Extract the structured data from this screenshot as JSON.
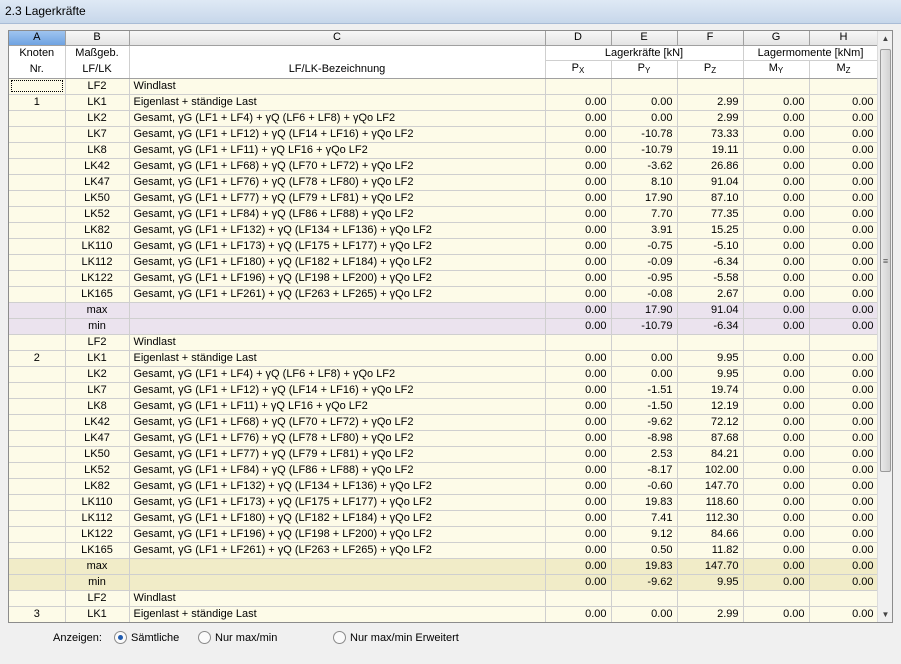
{
  "window": {
    "title": "2.3 Lagerkräfte"
  },
  "columns": {
    "letters": [
      "A",
      "B",
      "C",
      "D",
      "E",
      "F",
      "G",
      "H"
    ],
    "knoten": "Knoten",
    "nr": "Nr.",
    "massgeb": "Maßgeb.",
    "lflk": "LF/LK",
    "bezeichnung": "LF/LK-Bezeichnung",
    "lagerkraefte": "Lagerkräfte [kN]",
    "lagermomente": "Lagermomente [kNm]",
    "px": "P",
    "px_sub": "X",
    "py": "P",
    "py_sub": "Y",
    "pz": "P",
    "pz_sub": "Z",
    "my": "M",
    "my_sub": "Y",
    "mz": "M",
    "mz_sub": "Z"
  },
  "rows": [
    {
      "type": "row",
      "knot": "",
      "lk": "LF2",
      "desc": "Windlast",
      "px": "",
      "py": "",
      "pz": "",
      "my": "",
      "mz": ""
    },
    {
      "type": "row",
      "knot": "1",
      "lk": "LK1",
      "desc": "Eigenlast + ständige Last",
      "px": "0.00",
      "py": "0.00",
      "pz": "2.99",
      "my": "0.00",
      "mz": "0.00"
    },
    {
      "type": "row",
      "knot": "",
      "lk": "LK2",
      "desc": "Gesamt, γG (LF1 + LF4) + γQ (LF6 + LF8) + γQo LF2",
      "px": "0.00",
      "py": "0.00",
      "pz": "2.99",
      "my": "0.00",
      "mz": "0.00"
    },
    {
      "type": "row",
      "knot": "",
      "lk": "LK7",
      "desc": "Gesamt, γG (LF1 + LF12) + γQ (LF14 + LF16) + γQo LF2",
      "px": "0.00",
      "py": "-10.78",
      "pz": "73.33",
      "my": "0.00",
      "mz": "0.00"
    },
    {
      "type": "row",
      "knot": "",
      "lk": "LK8",
      "desc": "Gesamt, γG (LF1 + LF11) + γQ LF16 + γQo LF2",
      "px": "0.00",
      "py": "-10.79",
      "pz": "19.11",
      "my": "0.00",
      "mz": "0.00"
    },
    {
      "type": "row",
      "knot": "",
      "lk": "LK42",
      "desc": "Gesamt, γG (LF1 + LF68) + γQ (LF70 + LF72) + γQo LF2",
      "px": "0.00",
      "py": "-3.62",
      "pz": "26.86",
      "my": "0.00",
      "mz": "0.00"
    },
    {
      "type": "row",
      "knot": "",
      "lk": "LK47",
      "desc": "Gesamt, γG (LF1 + LF76) + γQ (LF78 + LF80) + γQo LF2",
      "px": "0.00",
      "py": "8.10",
      "pz": "91.04",
      "my": "0.00",
      "mz": "0.00"
    },
    {
      "type": "row",
      "knot": "",
      "lk": "LK50",
      "desc": "Gesamt, γG (LF1 + LF77) + γQ (LF79 + LF81) + γQo LF2",
      "px": "0.00",
      "py": "17.90",
      "pz": "87.10",
      "my": "0.00",
      "mz": "0.00"
    },
    {
      "type": "row",
      "knot": "",
      "lk": "LK52",
      "desc": "Gesamt, γG (LF1 + LF84) + γQ (LF86 + LF88) + γQo LF2",
      "px": "0.00",
      "py": "7.70",
      "pz": "77.35",
      "my": "0.00",
      "mz": "0.00"
    },
    {
      "type": "row",
      "knot": "",
      "lk": "LK82",
      "desc": "Gesamt, γG (LF1 + LF132) + γQ (LF134 + LF136) + γQo LF2",
      "px": "0.00",
      "py": "3.91",
      "pz": "15.25",
      "my": "0.00",
      "mz": "0.00"
    },
    {
      "type": "row",
      "knot": "",
      "lk": "LK110",
      "desc": "Gesamt, γG (LF1 + LF173) + γQ (LF175 + LF177) + γQo LF2",
      "px": "0.00",
      "py": "-0.75",
      "pz": "-5.10",
      "my": "0.00",
      "mz": "0.00"
    },
    {
      "type": "row",
      "knot": "",
      "lk": "LK112",
      "desc": "Gesamt, γG (LF1 + LF180) + γQ (LF182 + LF184) + γQo LF2",
      "px": "0.00",
      "py": "-0.09",
      "pz": "-6.34",
      "my": "0.00",
      "mz": "0.00"
    },
    {
      "type": "row",
      "knot": "",
      "lk": "LK122",
      "desc": "Gesamt, γG (LF1 + LF196) + γQ (LF198 + LF200) + γQo LF2",
      "px": "0.00",
      "py": "-0.95",
      "pz": "-5.58",
      "my": "0.00",
      "mz": "0.00"
    },
    {
      "type": "row",
      "knot": "",
      "lk": "LK165",
      "desc": "Gesamt, γG (LF1 + LF261) + γQ (LF263 + LF265) + γQo LF2",
      "px": "0.00",
      "py": "-0.08",
      "pz": "2.67",
      "my": "0.00",
      "mz": "0.00"
    },
    {
      "type": "mmp",
      "knot": "",
      "lk": "max",
      "desc": "",
      "px": "0.00",
      "py": "17.90",
      "pz": "91.04",
      "my": "0.00",
      "mz": "0.00"
    },
    {
      "type": "mmp",
      "knot": "",
      "lk": "min",
      "desc": "",
      "px": "0.00",
      "py": "-10.79",
      "pz": "-6.34",
      "my": "0.00",
      "mz": "0.00"
    },
    {
      "type": "row",
      "knot": "",
      "lk": "LF2",
      "desc": "Windlast",
      "px": "",
      "py": "",
      "pz": "",
      "my": "",
      "mz": ""
    },
    {
      "type": "row",
      "knot": "2",
      "lk": "LK1",
      "desc": "Eigenlast + ständige Last",
      "px": "0.00",
      "py": "0.00",
      "pz": "9.95",
      "my": "0.00",
      "mz": "0.00"
    },
    {
      "type": "row",
      "knot": "",
      "lk": "LK2",
      "desc": "Gesamt, γG (LF1 + LF4) + γQ (LF6 + LF8) + γQo LF2",
      "px": "0.00",
      "py": "0.00",
      "pz": "9.95",
      "my": "0.00",
      "mz": "0.00"
    },
    {
      "type": "row",
      "knot": "",
      "lk": "LK7",
      "desc": "Gesamt, γG (LF1 + LF12) + γQ (LF14 + LF16) + γQo LF2",
      "px": "0.00",
      "py": "-1.51",
      "pz": "19.74",
      "my": "0.00",
      "mz": "0.00"
    },
    {
      "type": "row",
      "knot": "",
      "lk": "LK8",
      "desc": "Gesamt, γG (LF1 + LF11) + γQ LF16 + γQo LF2",
      "px": "0.00",
      "py": "-1.50",
      "pz": "12.19",
      "my": "0.00",
      "mz": "0.00"
    },
    {
      "type": "row",
      "knot": "",
      "lk": "LK42",
      "desc": "Gesamt, γG (LF1 + LF68) + γQ (LF70 + LF72) + γQo LF2",
      "px": "0.00",
      "py": "-9.62",
      "pz": "72.12",
      "my": "0.00",
      "mz": "0.00"
    },
    {
      "type": "row",
      "knot": "",
      "lk": "LK47",
      "desc": "Gesamt, γG (LF1 + LF76) + γQ (LF78 + LF80) + γQo LF2",
      "px": "0.00",
      "py": "-8.98",
      "pz": "87.68",
      "my": "0.00",
      "mz": "0.00"
    },
    {
      "type": "row",
      "knot": "",
      "lk": "LK50",
      "desc": "Gesamt, γG (LF1 + LF77) + γQ (LF79 + LF81) + γQo LF2",
      "px": "0.00",
      "py": "2.53",
      "pz": "84.21",
      "my": "0.00",
      "mz": "0.00"
    },
    {
      "type": "row",
      "knot": "",
      "lk": "LK52",
      "desc": "Gesamt, γG (LF1 + LF84) + γQ (LF86 + LF88) + γQo LF2",
      "px": "0.00",
      "py": "-8.17",
      "pz": "102.00",
      "my": "0.00",
      "mz": "0.00"
    },
    {
      "type": "row",
      "knot": "",
      "lk": "LK82",
      "desc": "Gesamt, γG (LF1 + LF132) + γQ (LF134 + LF136) + γQo LF2",
      "px": "0.00",
      "py": "-0.60",
      "pz": "147.70",
      "my": "0.00",
      "mz": "0.00"
    },
    {
      "type": "row",
      "knot": "",
      "lk": "LK110",
      "desc": "Gesamt, γG (LF1 + LF173) + γQ (LF175 + LF177) + γQo LF2",
      "px": "0.00",
      "py": "19.83",
      "pz": "118.60",
      "my": "0.00",
      "mz": "0.00"
    },
    {
      "type": "row",
      "knot": "",
      "lk": "LK112",
      "desc": "Gesamt, γG (LF1 + LF180) + γQ (LF182 + LF184) + γQo LF2",
      "px": "0.00",
      "py": "7.41",
      "pz": "112.30",
      "my": "0.00",
      "mz": "0.00"
    },
    {
      "type": "row",
      "knot": "",
      "lk": "LK122",
      "desc": "Gesamt, γG (LF1 + LF196) + γQ (LF198 + LF200) + γQo LF2",
      "px": "0.00",
      "py": "9.12",
      "pz": "84.66",
      "my": "0.00",
      "mz": "0.00"
    },
    {
      "type": "row",
      "knot": "",
      "lk": "LK165",
      "desc": "Gesamt, γG (LF1 + LF261) + γQ (LF263 + LF265) + γQo LF2",
      "px": "0.00",
      "py": "0.50",
      "pz": "11.82",
      "my": "0.00",
      "mz": "0.00"
    },
    {
      "type": "mm",
      "knot": "",
      "lk": "max",
      "desc": "",
      "px": "0.00",
      "py": "19.83",
      "pz": "147.70",
      "my": "0.00",
      "mz": "0.00"
    },
    {
      "type": "mm",
      "knot": "",
      "lk": "min",
      "desc": "",
      "px": "0.00",
      "py": "-9.62",
      "pz": "9.95",
      "my": "0.00",
      "mz": "0.00"
    },
    {
      "type": "row",
      "knot": "",
      "lk": "LF2",
      "desc": "Windlast",
      "px": "",
      "py": "",
      "pz": "",
      "my": "",
      "mz": ""
    },
    {
      "type": "row",
      "knot": "3",
      "lk": "LK1",
      "desc": "Eigenlast + ständige Last",
      "px": "0.00",
      "py": "0.00",
      "pz": "2.99",
      "my": "0.00",
      "mz": "0.00"
    }
  ],
  "bottom": {
    "anzeigen_label": "Anzeigen:",
    "options": [
      {
        "label": "Sämtliche",
        "selected": true
      },
      {
        "label": "Nur max/min",
        "selected": false
      },
      {
        "label": "Nur max/min Erweitert",
        "selected": false
      }
    ]
  },
  "colors": {
    "row_bg": "#fdfbe8",
    "minmax_bg": "#f1ecc8",
    "minmax_first_bg": "#ebe3ee",
    "header_selected": "#6fa3e2"
  }
}
